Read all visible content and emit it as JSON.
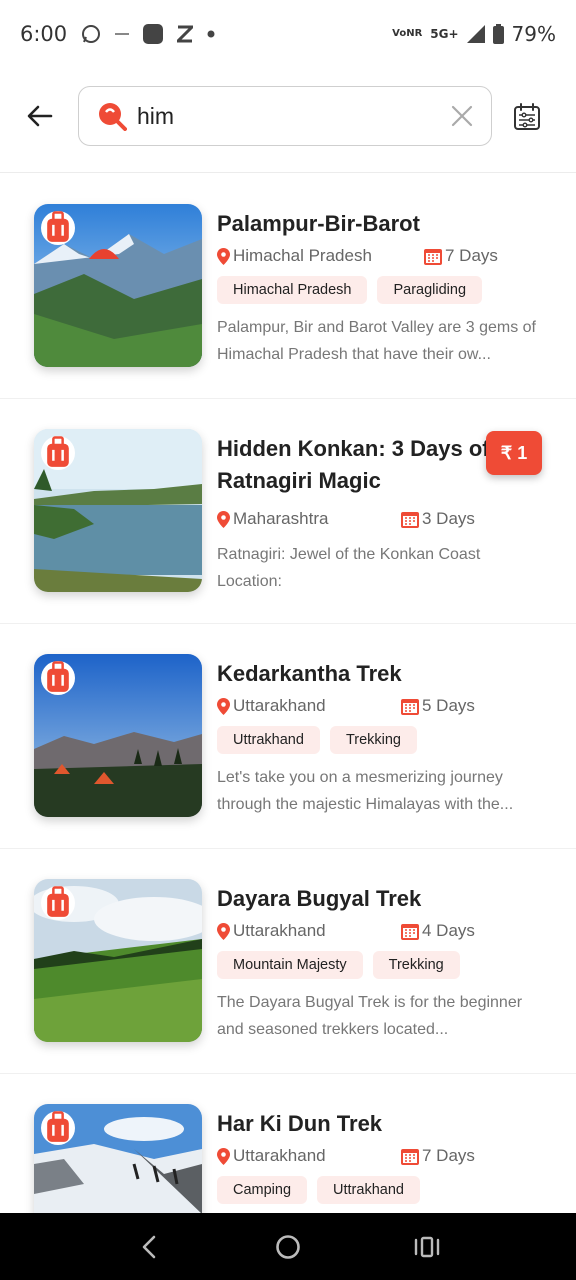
{
  "status_bar": {
    "time": "6:00",
    "carrier_small_1": "Vo",
    "carrier_small_2": "NR",
    "network": "5G+",
    "battery": "79%"
  },
  "search": {
    "value": "him",
    "placeholder": ""
  },
  "colors": {
    "accent": "#ef4b36",
    "tag_bg": "#fdecea"
  },
  "trips": [
    {
      "title": "Palampur-Bir-Barot",
      "location": "Himachal Pradesh",
      "duration": "7 Days",
      "tags": [
        "Himachal Pradesh",
        "Paragliding"
      ],
      "description": "Palampur, Bir and Barot Valley are 3 gems of Himachal Pradesh that have their ow..."
    },
    {
      "title": "Hidden Konkan: 3 Days of Ratnagiri Magic",
      "location": "Maharashtra",
      "duration": "3 Days",
      "tags": [],
      "description": "Ratnagiri: Jewel of the Konkan Coast Location:",
      "price_badge": "₹ 1"
    },
    {
      "title": "Kedarkantha Trek",
      "location": "Uttarakhand",
      "duration": "5 Days",
      "tags": [
        "Uttrakhand",
        "Trekking"
      ],
      "description": "Let's take you on a mesmerizing journey through the majestic Himalayas with the..."
    },
    {
      "title": "Dayara Bugyal Trek",
      "location": "Uttarakhand",
      "duration": "4 Days",
      "tags": [
        "Mountain Majesty",
        "Trekking"
      ],
      "description": "The Dayara Bugyal Trek is for the beginner and seasoned trekkers located..."
    },
    {
      "title": "Har Ki Dun Trek",
      "location": "Uttarakhand",
      "duration": "7 Days",
      "tags": [
        "Camping",
        "Uttrakhand"
      ],
      "description": ""
    }
  ]
}
